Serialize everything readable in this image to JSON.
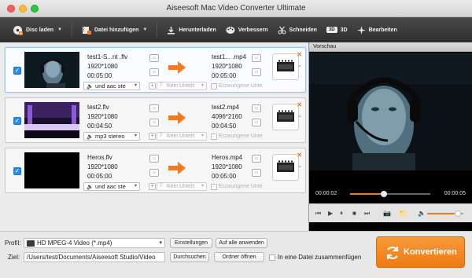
{
  "window": {
    "title": "Aiseesoft Mac Video Converter Ultimate"
  },
  "toolbar": {
    "disc_label": "Disc laden",
    "add_file_label": "Datei hinzufügen",
    "download_label": "Herunterladen",
    "enhance_label": "Verbessern",
    "clip_label": "Schneiden",
    "badge_3d": "3D",
    "label_3d": "3D",
    "edit_label": "Bearbeiten"
  },
  "files": [
    {
      "source_name": "test1-S...nt .flv",
      "source_res": "1920*1080",
      "source_dur": "00:05:00",
      "dest_name": "test1... .mp4",
      "dest_res": "1920*1080",
      "dest_dur": "00:05:00",
      "audio": "und aac ste",
      "subtitle": "Kein Untert",
      "force_sub": "Erzwungene Unte",
      "thumb": "man-headset"
    },
    {
      "source_name": "test2.flv",
      "source_res": "1920*1080",
      "source_dur": "00:04:50",
      "dest_name": "test2.mp4",
      "dest_res": "4096*2160",
      "dest_dur": "00:04:50",
      "audio": "mp3 stereo",
      "subtitle": "Kein Untert",
      "force_sub": "Erzwungene Unte",
      "thumb": "purple-stage"
    },
    {
      "source_name": "Heros.flv",
      "source_res": "1920*1080",
      "source_dur": "00:05:00",
      "dest_name": "Heros.mp4",
      "dest_res": "1920*1080",
      "dest_dur": "00:05:00",
      "audio": "und aac ste",
      "subtitle": "Kein Untert",
      "force_sub": "Erzwungene Unte",
      "thumb": "black"
    }
  ],
  "preview": {
    "label": "Vorschau",
    "current_time": "00:00:02",
    "total_time": "00:00:05",
    "progress": 0.42,
    "volume": 0.85
  },
  "bottom": {
    "profile_label": "Profil:",
    "profile_value": "HD MPEG-4 Video (*.mp4)",
    "settings_button": "Einstellungen",
    "apply_all_button": "Auf alle anwenden",
    "dest_label": "Ziel:",
    "dest_value": "/Users/test/Documents/Aiseesoft Studio/Video",
    "browse_button": "Durchsuchen",
    "open_folder_button": "Ordner öffnen",
    "merge_label": "In eine Datei zusammenfügen",
    "convert_button": "Konvertieren"
  },
  "colors": {
    "accent": "#f37b1d",
    "selection": "#2a8cf0"
  }
}
